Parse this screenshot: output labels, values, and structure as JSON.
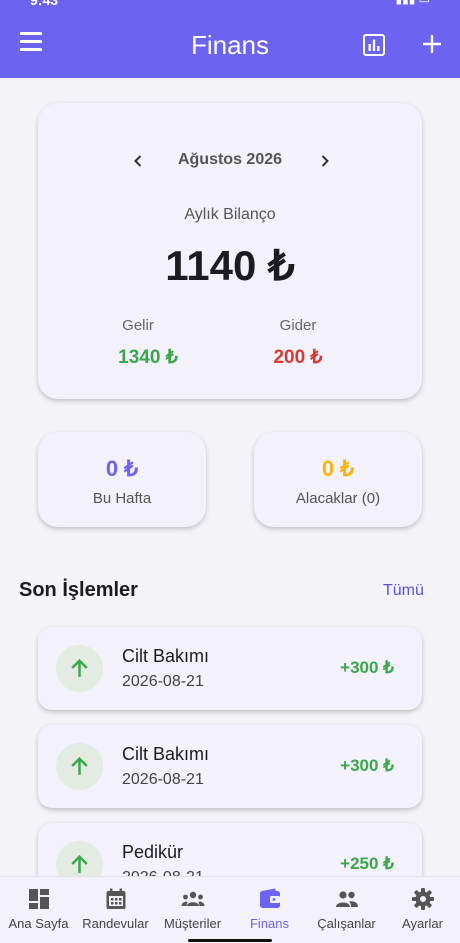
{
  "status_bar": {
    "time": "9:43"
  },
  "app_bar": {
    "title": "Finans"
  },
  "balance": {
    "month": "Ağustos 2026",
    "label": "Aylık Bilanço",
    "value": "1140 ₺",
    "income_label": "Gelir",
    "income_value": "1340 ₺",
    "expense_label": "Gider",
    "expense_value": "200 ₺"
  },
  "summary": {
    "week_value": "0 ₺",
    "week_label": "Bu Hafta",
    "receivables_value": "0 ₺",
    "receivables_label": "Alacaklar (0)"
  },
  "transactions": {
    "title": "Son İşlemler",
    "see_all": "Tümü",
    "items": [
      {
        "title": "Cilt Bakımı",
        "date": "2026-08-21",
        "amount": "+300 ₺"
      },
      {
        "title": "Cilt Bakımı",
        "date": "2026-08-21",
        "amount": "+300 ₺"
      },
      {
        "title": "Pedikür",
        "date": "2026-08-21",
        "amount": "+250 ₺"
      }
    ]
  },
  "bottom_nav": {
    "items": [
      {
        "label": "Ana Sayfa",
        "icon": "dashboard-icon"
      },
      {
        "label": "Randevular",
        "icon": "calendar-icon"
      },
      {
        "label": "Müşteriler",
        "icon": "groups-icon"
      },
      {
        "label": "Finans",
        "icon": "wallet-icon",
        "active": true
      },
      {
        "label": "Çalışanlar",
        "icon": "people-icon"
      },
      {
        "label": "Ayarlar",
        "icon": "gear-icon"
      }
    ]
  },
  "colors": {
    "primary": "#6c63f0",
    "income": "#3aa84a",
    "expense": "#d93a32",
    "week_value": "#6c63f0",
    "receivables_value": "#f5b50c"
  }
}
